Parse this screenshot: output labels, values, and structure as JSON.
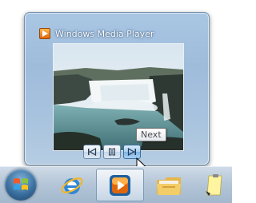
{
  "preview": {
    "title": "Windows Media Player",
    "icon": "windows-media-player-icon"
  },
  "controls": [
    {
      "name": "previous-button",
      "icon": "skip-previous-icon"
    },
    {
      "name": "pause-button",
      "icon": "pause-icon"
    },
    {
      "name": "next-button",
      "icon": "skip-next-icon"
    }
  ],
  "tooltip": "Next",
  "taskbar": {
    "items": [
      "start-orb",
      "internet-explorer-icon",
      "windows-media-player-icon",
      "windows-explorer-icon",
      "notepad-icon"
    ]
  },
  "colors": {
    "preview_frame": "#a9c6e3",
    "taskbar": "#b4c6d8",
    "wmp_orange": "#e0660a"
  }
}
